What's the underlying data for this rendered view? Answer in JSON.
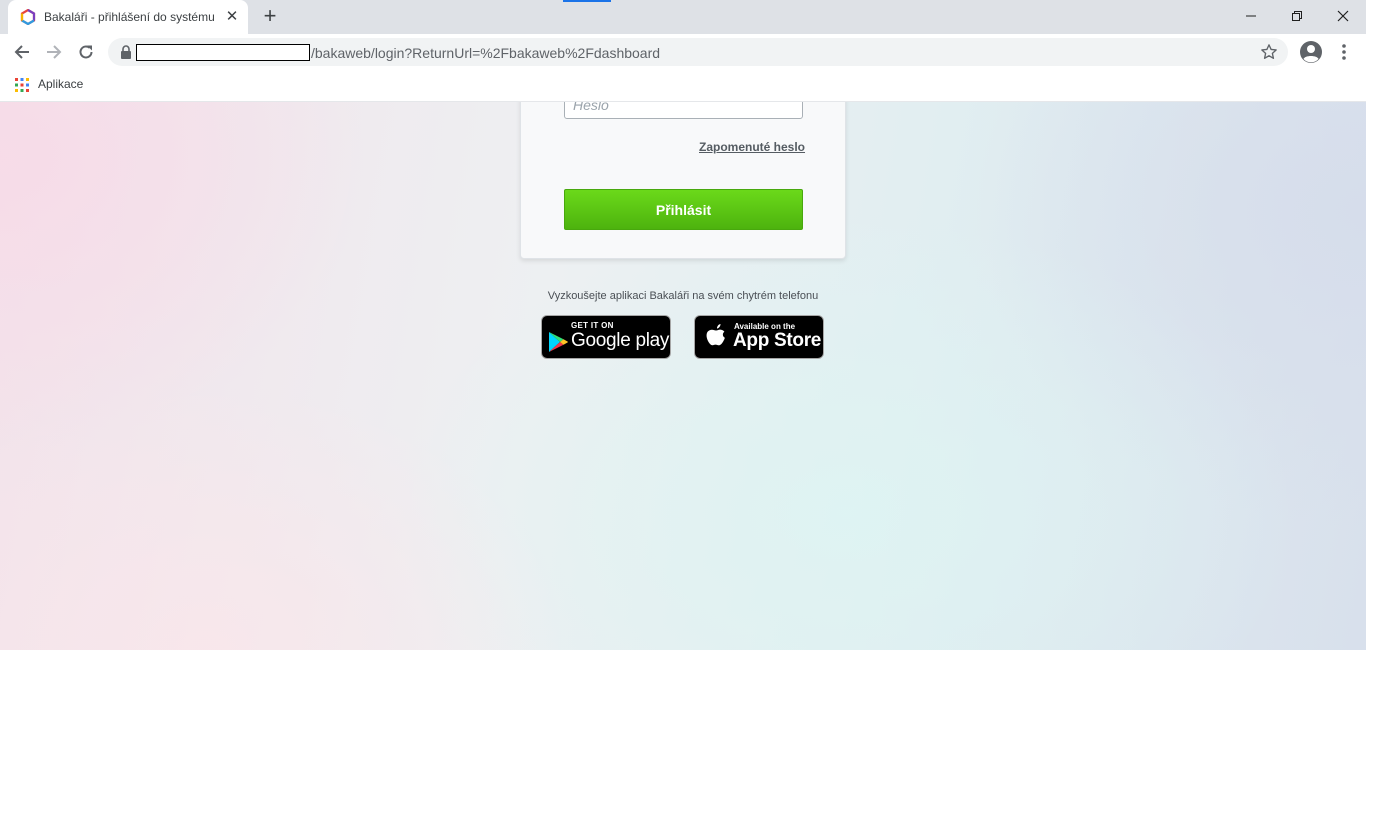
{
  "browser": {
    "tab": {
      "title": "Bakaláři - přihlášení do systému",
      "favicon": "bakalari-logo-icon",
      "close_glyph": "✕"
    },
    "new_tab_glyph": "+",
    "window_controls": [
      "minimize-icon",
      "maximize-icon",
      "close-icon"
    ],
    "toolbar": {
      "back": "arrow-left-icon",
      "forward": "arrow-right-icon",
      "reload": "reload-icon",
      "url_path": "/bakaweb/login?ReturnUrl=%2Fbakaweb%2Fdashboard",
      "url_host_redacted": true
    },
    "bookmarks": {
      "apps_label": "Aplikace"
    },
    "accent_color": "#1a73e8"
  },
  "login": {
    "password_placeholder": "Heslo",
    "forgot_password": "Zapomenuté heslo",
    "submit_label": "Přihlásit",
    "button_color": "#5ec414"
  },
  "promo": {
    "text": "Vyzkoušejte aplikaci Bakaláři na svém chytrém telefonu",
    "google": {
      "small": "GET IT ON",
      "big": "Google play"
    },
    "apple": {
      "small": "Available on the",
      "big": "App Store"
    }
  }
}
